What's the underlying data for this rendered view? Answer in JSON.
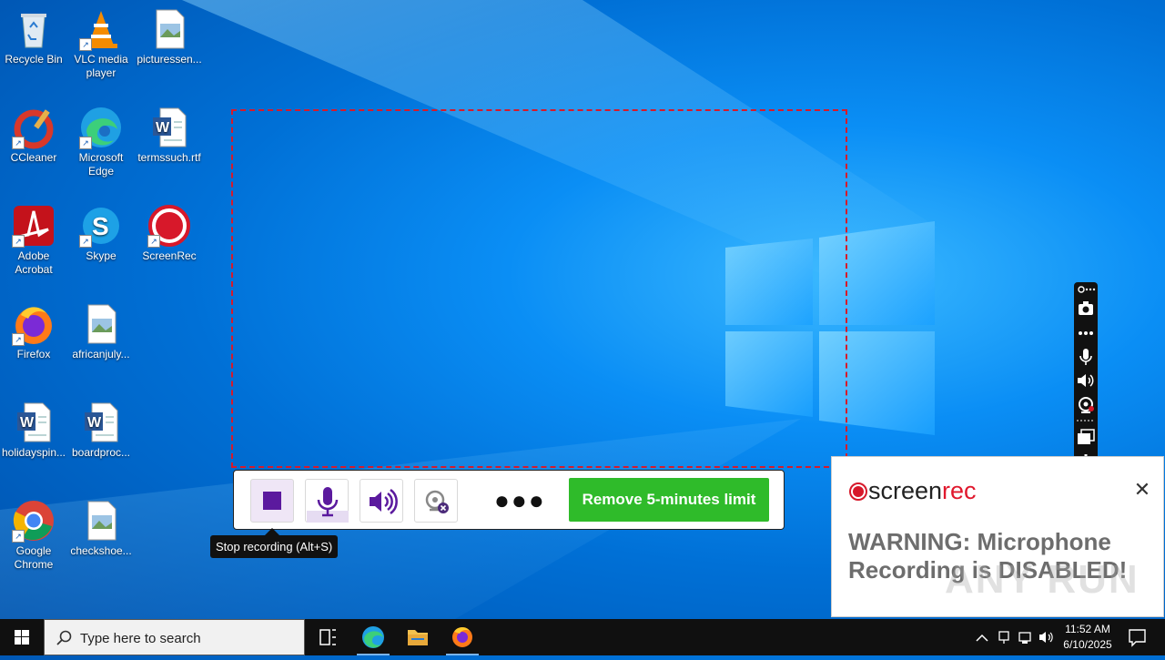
{
  "desktop_icons": [
    {
      "label": "Recycle Bin",
      "icon": "recycle-bin-icon"
    },
    {
      "label": "VLC media player",
      "icon": "vlc-icon"
    },
    {
      "label": "picturessen...",
      "icon": "image-file-icon"
    },
    {
      "label": "CCleaner",
      "icon": "ccleaner-icon"
    },
    {
      "label": "Microsoft Edge",
      "icon": "edge-icon"
    },
    {
      "label": "termssuch.rtf",
      "icon": "word-doc-icon"
    },
    {
      "label": "Adobe Acrobat",
      "icon": "acrobat-icon"
    },
    {
      "label": "Skype",
      "icon": "skype-icon"
    },
    {
      "label": "ScreenRec",
      "icon": "screenrec-icon"
    },
    {
      "label": "Firefox",
      "icon": "firefox-icon"
    },
    {
      "label": "africanjuly...",
      "icon": "image-file-icon"
    },
    {
      "label": "holidayspin...",
      "icon": "word-doc-icon"
    },
    {
      "label": "boardproc...",
      "icon": "word-doc-icon"
    },
    {
      "label": "Google Chrome",
      "icon": "chrome-icon"
    },
    {
      "label": "checkshoe...",
      "icon": "image-file-icon"
    }
  ],
  "recorder": {
    "limit_button": "Remove 5-minutes limit",
    "tooltip": "Stop recording (Alt+S)",
    "more": "●●●",
    "accent": "#5b1a9e",
    "border_color": "#d71a2a",
    "limit_color": "#2fbb2a"
  },
  "side_toolbar": {
    "icons": [
      "link-icon",
      "camera-icon",
      "more-icon",
      "microphone-icon",
      "speaker-icon",
      "webcam-icon",
      "window-icon",
      "gear-icon"
    ]
  },
  "warning": {
    "brand_prefix": "screen",
    "brand_suffix": "rec",
    "close": "✕",
    "message": "WARNING: Microphone Recording is DISABLED!",
    "watermark": "ANY RUN"
  },
  "taskbar": {
    "search_placeholder": "Type here to search",
    "time": "11:52 AM",
    "date": "6/10/2025"
  }
}
